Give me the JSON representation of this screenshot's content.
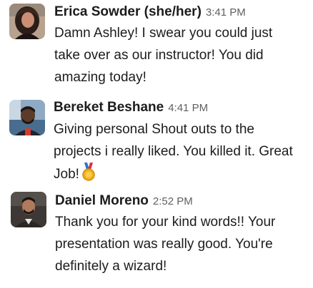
{
  "messages": [
    {
      "author": "Erica Sowder (she/her)",
      "time": "3:41 PM",
      "lines": [
        "Damn Ashley! I swear you could just",
        "take over as our instructor! You did",
        "amazing today!"
      ]
    },
    {
      "author": "Bereket Beshane",
      "time": "4:41 PM",
      "lines": [
        "Giving personal Shout outs to the",
        "projects i really liked. You killed it. Great",
        "Job!"
      ],
      "emoji": "medal-icon"
    },
    {
      "author": "Daniel Moreno",
      "time": "2:52 PM",
      "lines": [
        "Thank you for your kind words!! Your",
        "presentation was really good. You're",
        "definitely a wizard!"
      ]
    }
  ]
}
